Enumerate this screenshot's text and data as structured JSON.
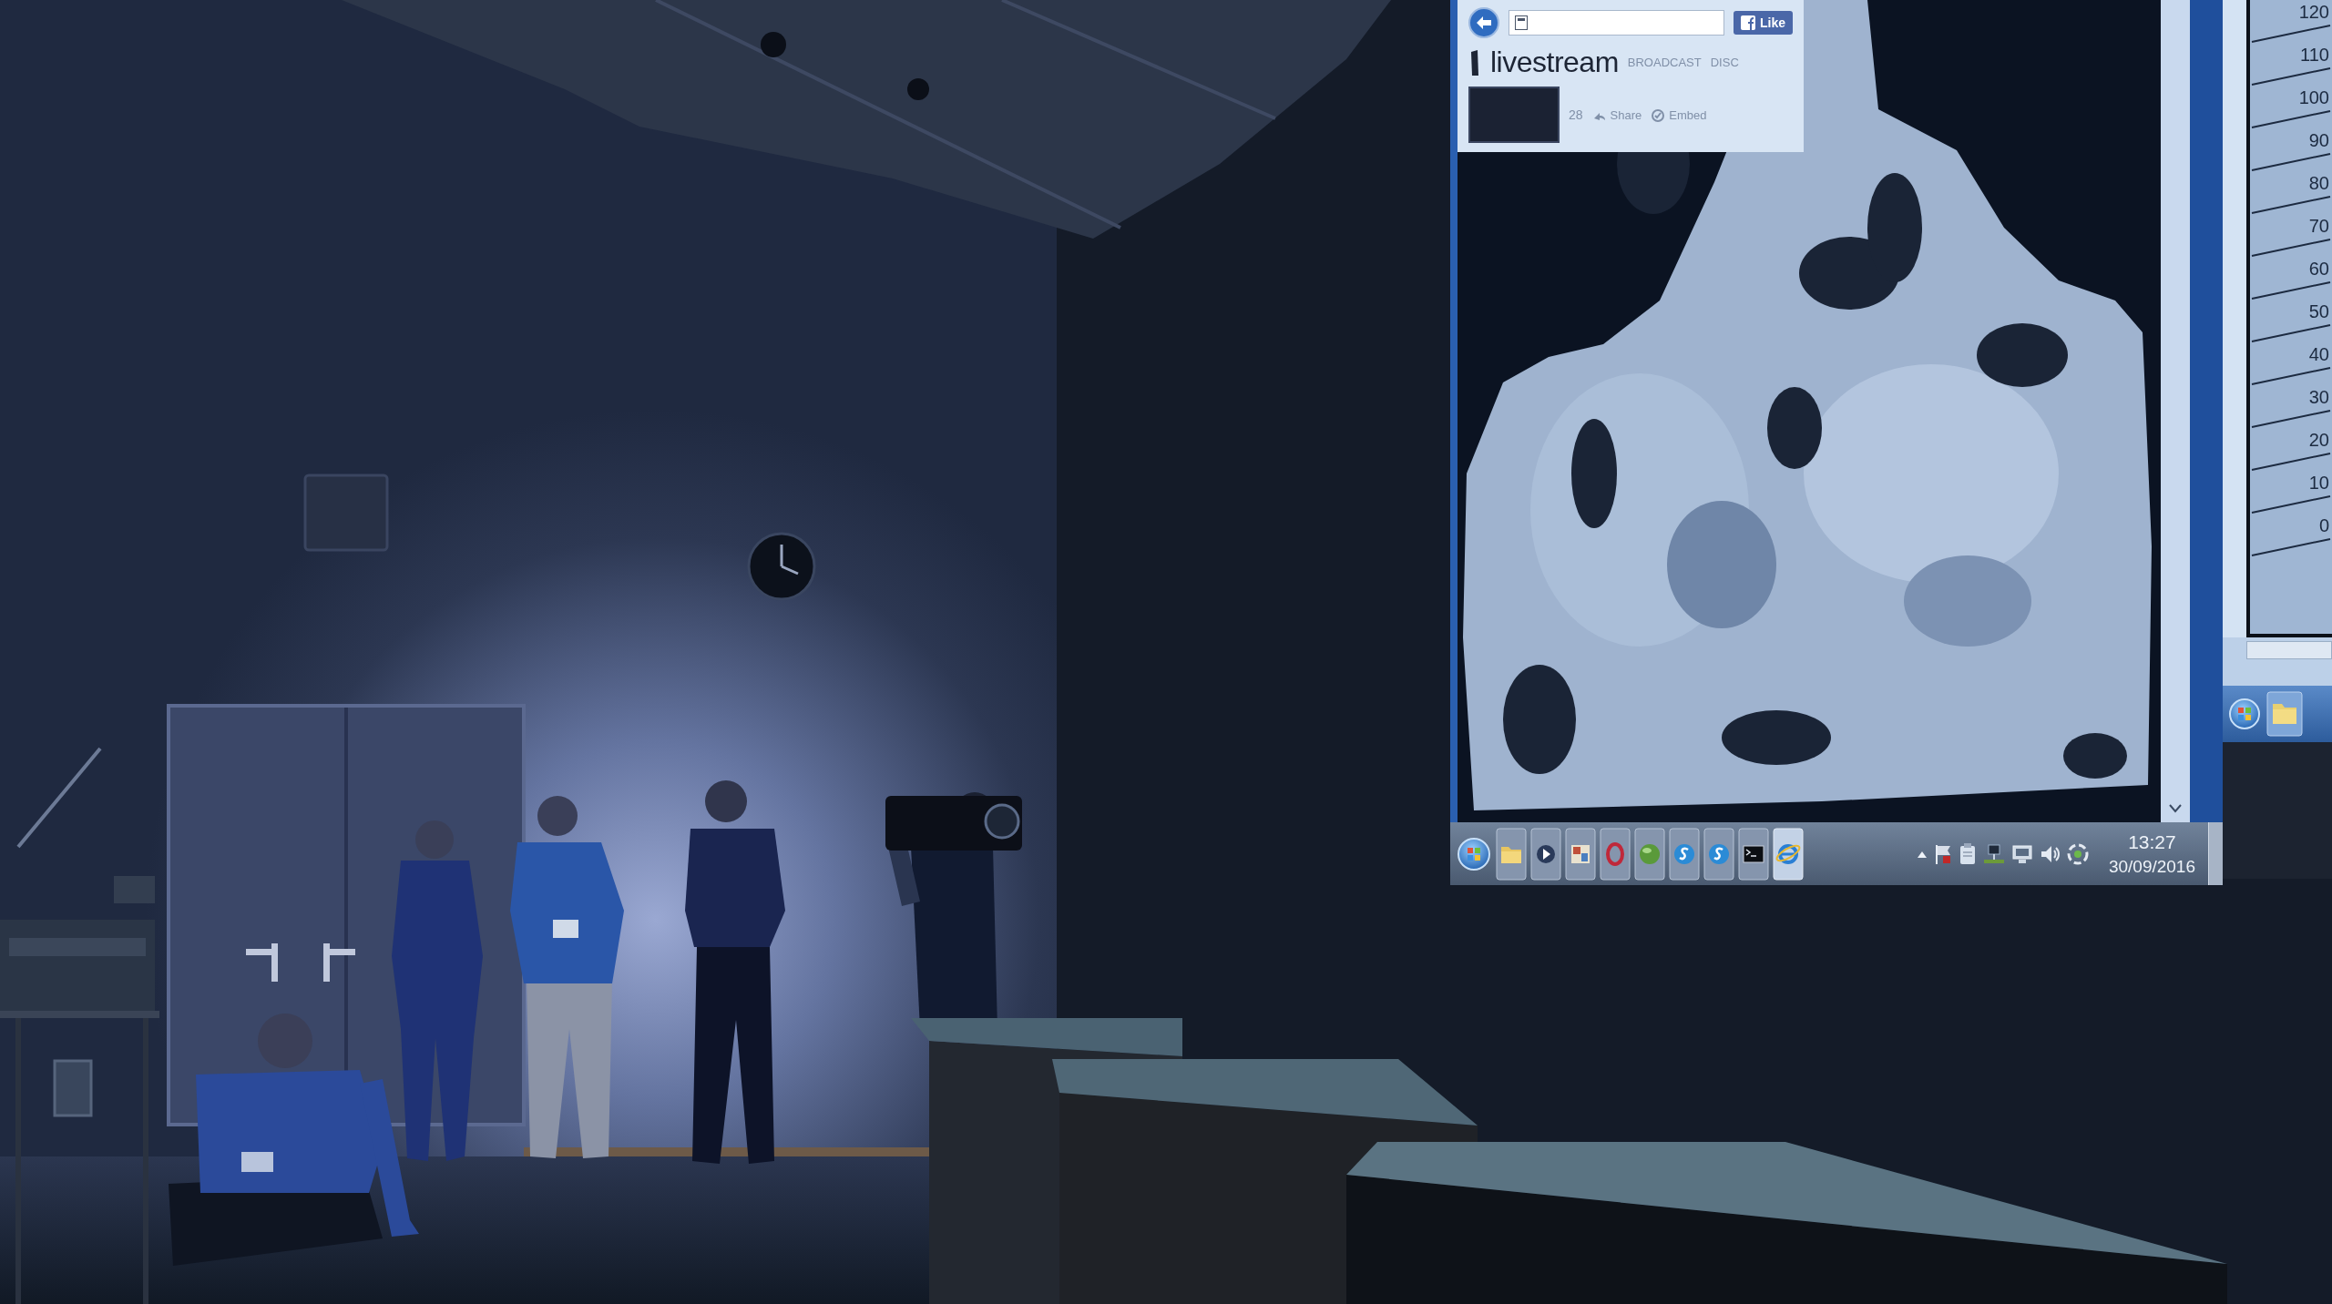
{
  "browser": {
    "logo": "livestream",
    "nav": [
      "BROADCAST",
      "DISC"
    ],
    "like_button": "Like",
    "viewer_count": "28",
    "actions": [
      {
        "kind": "share",
        "label": "Share"
      },
      {
        "kind": "embed",
        "label": "Embed"
      }
    ]
  },
  "taskbar": {
    "time": "13:27",
    "date": "30/09/2016"
  },
  "second_monitor": {
    "scale_labels": [
      "120",
      "110",
      "100",
      "90",
      "80",
      "70",
      "60",
      "50",
      "40",
      "30",
      "20",
      "10",
      "0"
    ]
  }
}
